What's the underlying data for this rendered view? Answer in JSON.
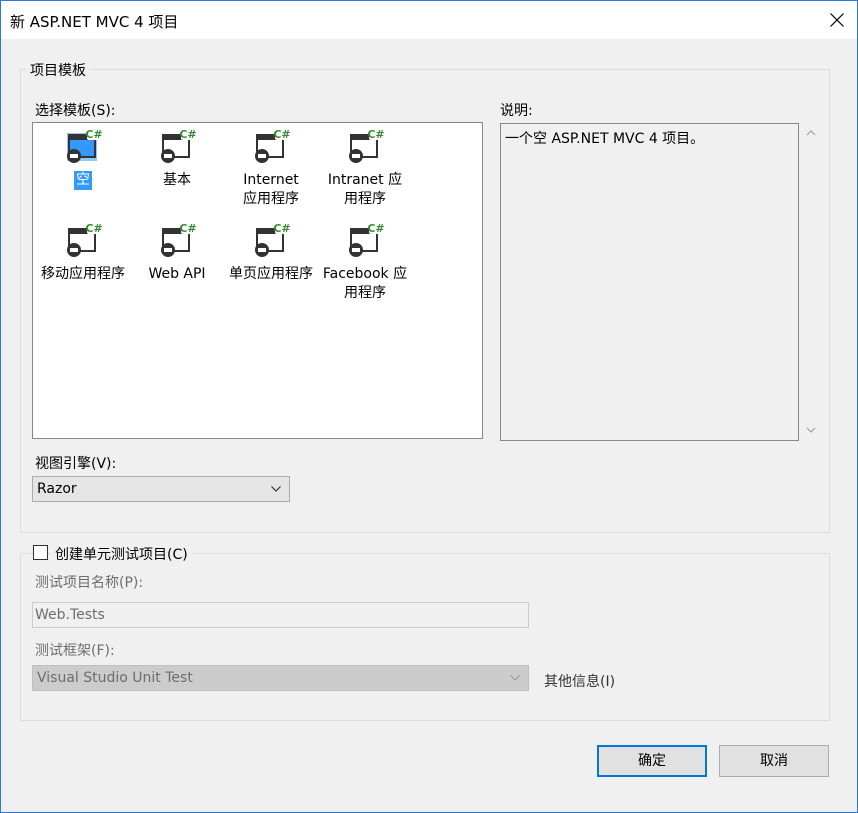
{
  "window": {
    "title": "新 ASP.NET MVC 4 项目",
    "close_glyph": "×"
  },
  "project_template": {
    "group_label": "项目模板",
    "select_label": "选择模板(S):",
    "templates": [
      {
        "label": "空",
        "icon": "empty-project-icon",
        "selected": true
      },
      {
        "label": "基本",
        "icon": "basic-project-icon",
        "selected": false
      },
      {
        "label": "Internet 应用程序",
        "icon": "internet-app-icon",
        "selected": false
      },
      {
        "label": "Intranet 应用程序",
        "icon": "intranet-app-icon",
        "selected": false
      },
      {
        "label": "移动应用程序",
        "icon": "mobile-app-icon",
        "selected": false
      },
      {
        "label": "Web API",
        "icon": "web-api-icon",
        "selected": false
      },
      {
        "label": "单页应用程序",
        "icon": "single-page-app-icon",
        "selected": false
      },
      {
        "label": "Facebook 应用程序",
        "icon": "facebook-app-icon",
        "selected": false
      }
    ],
    "description_label": "说明:",
    "description_text": "一个空 ASP.NET MVC 4 项目。",
    "view_engine_label": "视图引擎(V):",
    "view_engine_value": "Razor"
  },
  "unit_test": {
    "checkbox_label": "创建单元测试项目(C)",
    "checked": false,
    "project_name_label": "测试项目名称(P):",
    "project_name_value": "Web.Tests",
    "framework_label": "测试框架(F):",
    "framework_value": "Visual Studio Unit Test",
    "more_info_label": "其他信息(I)"
  },
  "buttons": {
    "ok_label": "确定",
    "cancel_label": "取消"
  },
  "colors": {
    "selection": "#3399ff",
    "accent_border": "#0078d7",
    "csharp_badge": "#388a34"
  }
}
